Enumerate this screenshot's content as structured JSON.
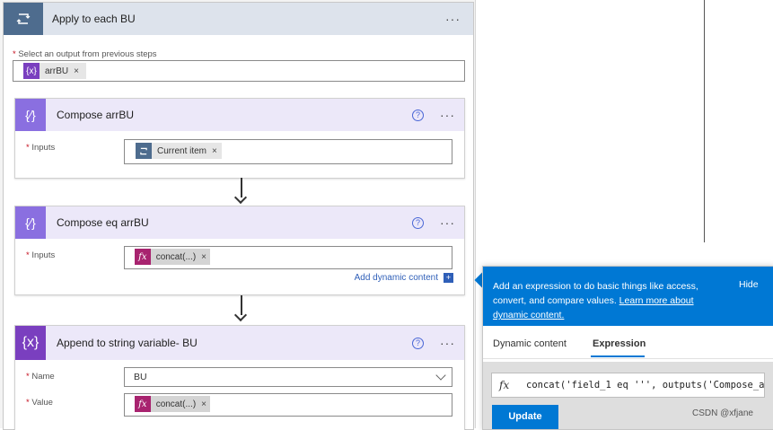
{
  "loop": {
    "title": "Apply to each BU",
    "more": "···",
    "select_label": "Select an output from previous steps",
    "select_token": {
      "label": "arrBU",
      "icon": "{x}",
      "remove": "×"
    }
  },
  "compose1": {
    "title": "Compose arrBU",
    "help": "?",
    "more": "···",
    "inputs_label": "Inputs",
    "token": {
      "label": "Current item",
      "remove": "×"
    }
  },
  "compose2": {
    "title": "Compose eq arrBU",
    "help": "?",
    "more": "···",
    "inputs_label": "Inputs",
    "token": {
      "label": "concat(...)",
      "icon": "fx",
      "remove": "×"
    },
    "add_dynamic": "Add dynamic content"
  },
  "append": {
    "title": "Append to string variable- BU",
    "icon": "{x}",
    "help": "?",
    "more": "···",
    "name_label": "Name",
    "name_value": "BU",
    "value_label": "Value",
    "token": {
      "label": "concat(...)",
      "icon": "fx",
      "remove": "×"
    }
  },
  "panel": {
    "description": "Add an expression to do basic things like access, convert, and compare values.",
    "learn_more": "Learn more about dynamic content.",
    "hide": "Hide",
    "tabs": [
      {
        "label": "Dynamic content",
        "active": false
      },
      {
        "label": "Expression",
        "active": true
      }
    ],
    "fx": "fx",
    "expression": "concat('field_1 eq ''', outputs('Compose_a",
    "update": "Update"
  },
  "watermark": "CSDN @xfjane",
  "colors": {
    "loop_header": "#dde3ec",
    "loop_icon": "#4e6c8e",
    "compose_icon": "#8a6fe0",
    "variable_icon": "#7a3fbf",
    "fx_token": "#a8236f",
    "accent": "#0078d4"
  }
}
